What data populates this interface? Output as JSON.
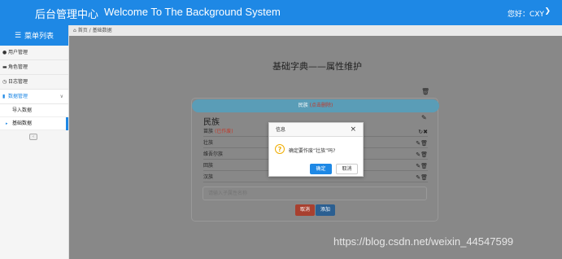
{
  "header": {
    "brand": "后台管理中心",
    "welcome": "Welcome To The Background System",
    "user": "您好：CXY"
  },
  "sidebar": {
    "title": "菜单列表",
    "items": [
      {
        "label": "用户管理",
        "icon": "user-icon"
      },
      {
        "label": "角色管理",
        "icon": "folder-icon"
      },
      {
        "label": "日志管理",
        "icon": "clock-icon"
      },
      {
        "label": "数据管理",
        "icon": "chart-icon"
      }
    ],
    "sub_items": [
      {
        "label": "导入数据"
      },
      {
        "label": "基础数据"
      }
    ]
  },
  "breadcrumb": {
    "home": "首页",
    "sep": "/",
    "current": "基础数据"
  },
  "page": {
    "title": "基础字典——属性维护",
    "pill_label": "民族",
    "pill_hint": "(点击删除)",
    "group_title": "民族",
    "rows": [
      {
        "label": "苗族",
        "hint": "(已作废)"
      },
      {
        "label": "壮族",
        "hint": ""
      },
      {
        "label": "维吾尔族",
        "hint": ""
      },
      {
        "label": "回族",
        "hint": ""
      },
      {
        "label": "汉族",
        "hint": ""
      }
    ],
    "input_placeholder": "请输入子属性名称",
    "cancel_label": "取消",
    "add_label": "添加"
  },
  "dialog": {
    "title": "信息",
    "message": "确定要作废“壮族”吗?",
    "ok_label": "确定",
    "cancel_label": "取消"
  },
  "watermark": "https://blog.csdn.net/weixin_44547599"
}
